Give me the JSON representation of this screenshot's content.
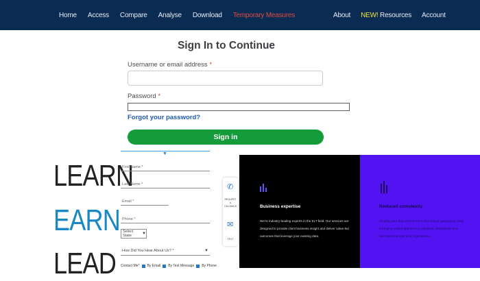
{
  "nav": {
    "left": [
      "Home",
      "Access",
      "Compare",
      "Analyse",
      "Download",
      "Temporary Measures"
    ],
    "right": {
      "about": "About",
      "resources_new": "NEW!",
      "resources": "Resources",
      "account": "Account"
    }
  },
  "signin": {
    "title": "Sign In to Continue",
    "username_label": "Username or email address",
    "username_value": "",
    "password_label": "Password",
    "password_value": "",
    "required_mark": "*",
    "forgot": "Forgot your password?",
    "button": "Sign in"
  },
  "promo": {
    "learn": "LEARN",
    "earn": "EARN",
    "lead": "LEAD"
  },
  "mini_form": {
    "first_name": "First Name *",
    "last_name": "Last Name *",
    "email": "Email *",
    "phone": "Phone *",
    "state": "Select State",
    "hear": "How Did You Hear About Us? *",
    "contact_label": "Contact Me*",
    "contact_options": [
      "By Email",
      "By Text Message",
      "By Phone"
    ]
  },
  "side_widget": {
    "call_text": "REQUEST A CALLBACK",
    "chat_text": "TEXT"
  },
  "panels": {
    "left": {
      "title": "Business expertise",
      "lines": [
        "We're industry-leading experts in the ELT field. Our services are",
        "designed to provide client business insight and deliver value-led",
        "outcomes that leverage your existing data."
      ]
    },
    "right": {
      "title": "Reduced complexity",
      "lines": [
        "Simplify your data environment and reduce operational costs",
        "through a unified approach to pipelines, integrations and",
        "automation across your organisation."
      ]
    }
  },
  "colors": {
    "nav_bg": "#0b2c52",
    "alert": "#e24a43",
    "new_badge": "#f2e23a",
    "signin_green": "#149c3a",
    "link_blue": "#1f5ab4",
    "earn_blue": "#1a88c4",
    "panel_purple": "#5312f2"
  }
}
